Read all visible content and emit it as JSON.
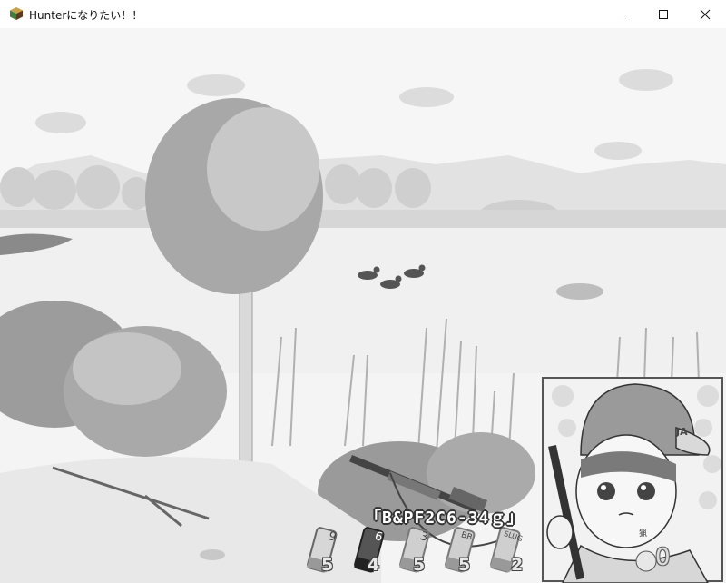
{
  "window": {
    "title": "Hunterになりたい！！",
    "icon": "app-cube-icon",
    "controls": [
      "minimize-icon",
      "maximize-icon",
      "close-icon"
    ]
  },
  "hud": {
    "selected_ammo": "「B&PF2C6-34ｇ」",
    "score": "0",
    "cap_text": "JA",
    "badge_text": "猟",
    "shells": [
      {
        "name": "9",
        "count": "5"
      },
      {
        "name": "6",
        "count": "4",
        "selected": true
      },
      {
        "name": "3",
        "count": "5"
      },
      {
        "name": "BB",
        "count": "5"
      },
      {
        "name": "SLUG",
        "count": "2"
      }
    ]
  },
  "scene": {
    "ducks": 3,
    "palette": "grayscale"
  }
}
